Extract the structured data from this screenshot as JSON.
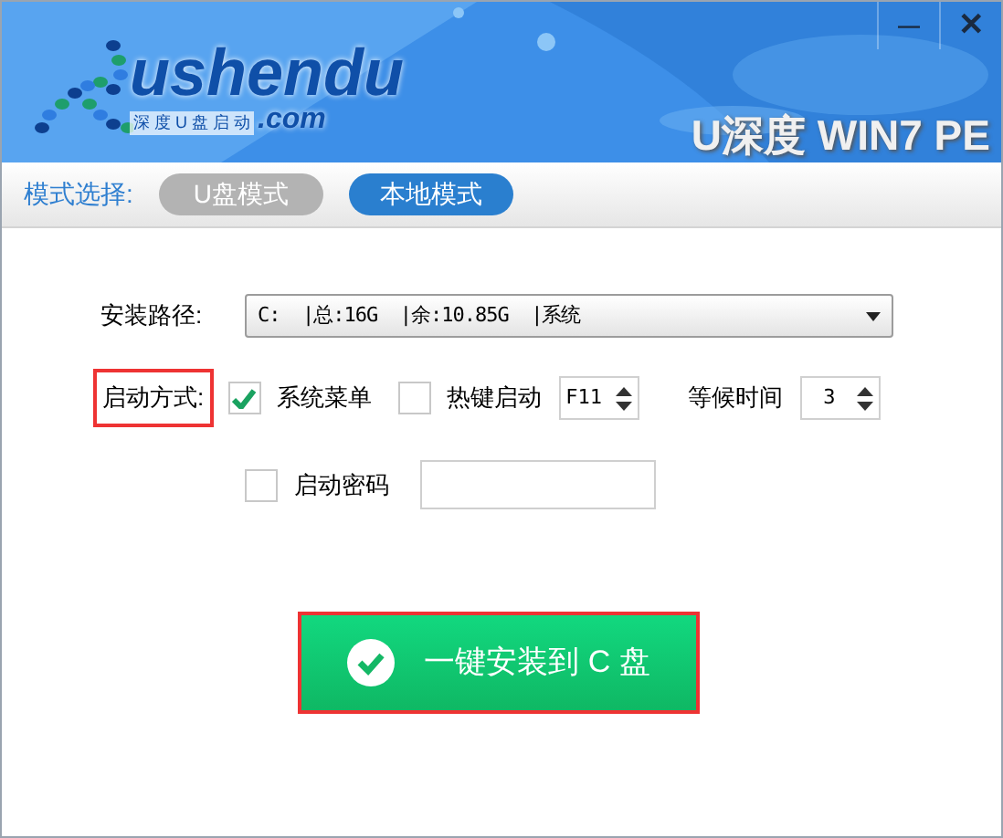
{
  "window": {
    "controls": [
      {
        "kind": "minimize",
        "label": "—"
      },
      {
        "kind": "close",
        "label": "✕"
      }
    ]
  },
  "logo": {
    "name": "ushendu",
    "domain": ".com",
    "tagline": "深 度 U 盘 启 动"
  },
  "product_title": "U深度 WIN7 PE",
  "mode_bar": {
    "label": "模式选择:",
    "modes": [
      {
        "label": "U盘模式",
        "selected": false
      },
      {
        "label": "本地模式",
        "selected": true
      }
    ]
  },
  "install_path": {
    "label": "安装路径:",
    "value": "C:  |总:16G  |余:10.85G  |系统"
  },
  "boot": {
    "label": "启动方式:",
    "highlighted": true,
    "options": [
      {
        "label": "系统菜单",
        "checked": true
      },
      {
        "label": "热键启动",
        "checked": false
      }
    ],
    "hotkey": "F11",
    "wait_label": "等候时间",
    "wait_value": "3"
  },
  "password": {
    "label": "启动密码",
    "checked": false
  },
  "install_button": {
    "label": "一键安装到 C 盘",
    "highlighted": true
  }
}
